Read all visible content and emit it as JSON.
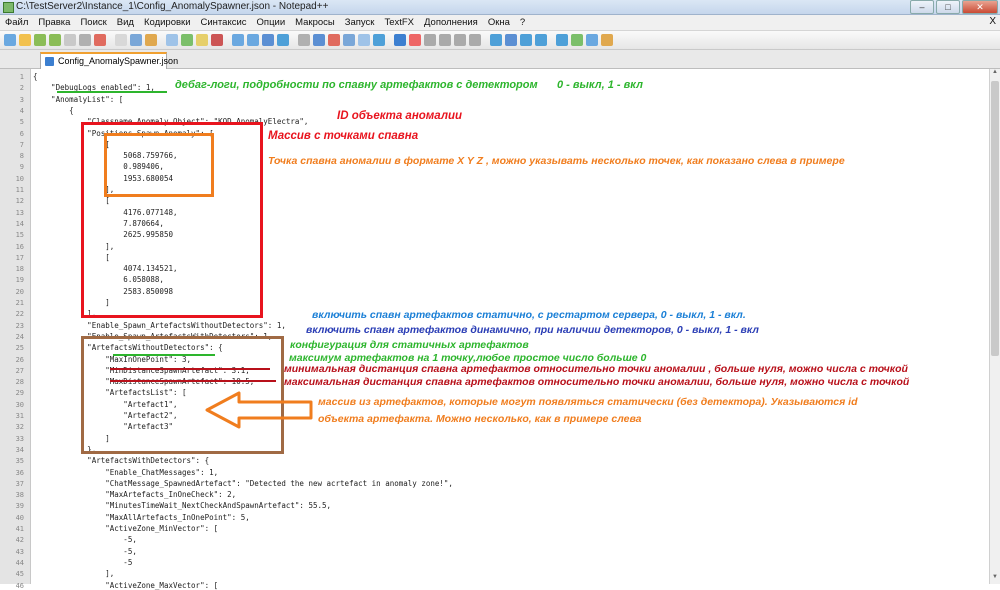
{
  "window": {
    "title": "C:\\TestServer2\\Instance_1\\Config_AnomalySpawner.json - Notepad++",
    "min": "–",
    "max": "□",
    "close": "✕"
  },
  "menu": [
    "Файл",
    "Правка",
    "Поиск",
    "Вид",
    "Кодировки",
    "Синтаксис",
    "Опции",
    "Макросы",
    "Запуск",
    "TextFX",
    "Дополнения",
    "Окна",
    "?"
  ],
  "menu_close": "X",
  "tab": {
    "label": "Config_AnomalySpawner.json"
  },
  "lines": [
    "{",
    "    \"DebugLogs_enabled\": 1,",
    "    \"AnomalyList\": [",
    "        {",
    "            \"Classname Anomaly Object\": \"KOD AnomalyElectra\",",
    "            \"Positions Spawn Anomaly\": [",
    "                [",
    "                    5068.759766,",
    "                    0.989406,",
    "                    1953.680054",
    "                ],",
    "                [",
    "                    4176.077148,",
    "                    7.870664,",
    "                    2625.995850",
    "                ],",
    "                [",
    "                    4074.134521,",
    "                    6.058088,",
    "                    2583.850098",
    "                ]",
    "            ],",
    "            \"Enable_Spawn_ArtefactsWithoutDetectors\": 1,",
    "            \"Enable_Spawn_ArtefactsWithDetectors\": 1,",
    "            \"ArtefactsWithoutDetectors\": {",
    "                \"MaxInOnePoint\": 3,",
    "                \"MinDistanceSpawnArtefact\": 3.1,",
    "                \"MaxDistanceSpawnArtefact\": 10.5,",
    "                \"ArtefactsList\": [",
    "                    \"Artefact1\",",
    "                    \"Artefact2\",",
    "                    \"Artefact3\"",
    "                ]",
    "            },",
    "            \"ArtefactsWithDetectors\": {",
    "                \"Enable_ChatMessages\": 1,",
    "                \"ChatMessage_SpawnedArtefact\": \"Detected the new acrtefact in anomaly zone!\",",
    "                \"MaxArtefacts_InOneCheck\": 2,",
    "                \"MinutesTimeWait_NextCheckAndSpawnArtefact\": 55.5,",
    "                \"MaxAllArtefacts_InOnePoint\": 5,",
    "                \"ActiveZone_MinVector\": [",
    "                    -5,",
    "                    -5,",
    "                    -5",
    "                ],",
    "                \"ActiveZone_MaxVector\": ["
  ],
  "annotations": {
    "debug": "дебаг-логи, подробности по спавну артефактов с детектором",
    "debug_values": "0 - выкл, 1 - вкл",
    "id_anomaly": "ID объекта аномалии",
    "spawn_array": "Массив с точками спавна",
    "spawn_point": "Точка спавна аномалии в формате X Y Z , можно указывать несколько точек, как показано слева в примере",
    "static_spawn": "включить спавн артефактов статично, с рестартом сервера, 0 - выкл, 1 - вкл.",
    "dynamic_spawn": "включить спавн артефактов динамично, при наличии детекторов, 0 - выкл, 1 - вкл",
    "static_config": "конфигурация для статичных артефактов",
    "max_in_point": "максимум артефактов на 1 точку,любое простое число больше 0",
    "min_distance": "минимальная дистанция спавна артефактов относительно точки аномалии , больше нуля, можно числа с точкой",
    "max_distance": "максимальная дистанция спавна артефактов относительно точки аномалии, больше нуля, можно числа с точкой",
    "artefacts_list_1": "массив из артефактов, которые могут появляться статически (без детектора). Указываются id",
    "artefacts_list_2": "объекта артефакта. Можно несколько, как в примере слева"
  },
  "colors": {
    "green": "#2db52d",
    "red": "#e8141e",
    "orange": "#f07d1e",
    "blue": "#1a7fd6",
    "darkblue": "#2a3db5",
    "darkred": "#b8101a",
    "brown": "#a06a44"
  }
}
